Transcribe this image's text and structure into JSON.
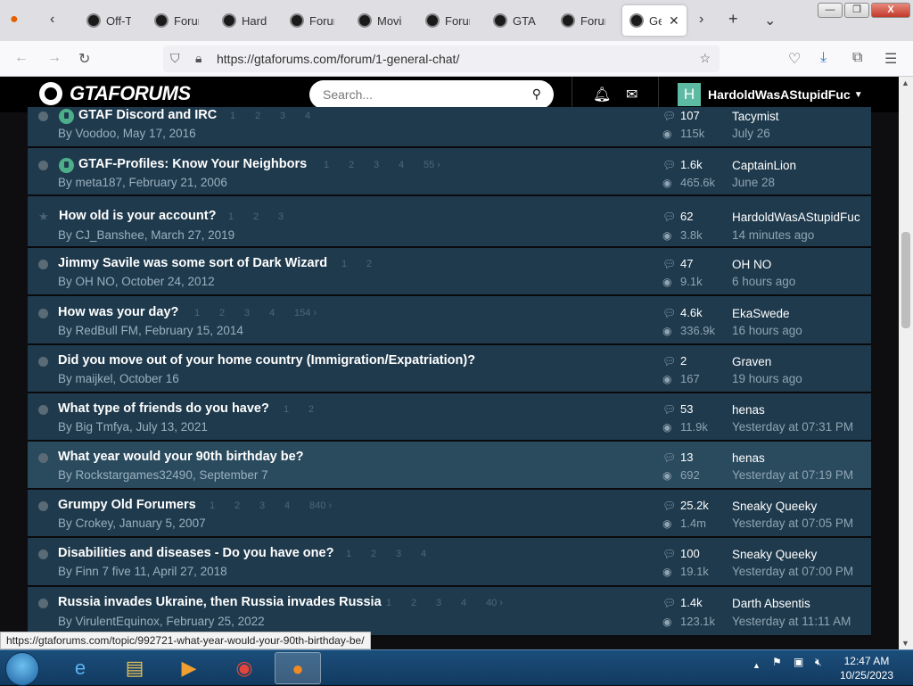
{
  "browser": {
    "tabs": [
      {
        "title": "Off-To"
      },
      {
        "title": "Forum"
      },
      {
        "title": "Hardc"
      },
      {
        "title": "Forum"
      },
      {
        "title": "Movie"
      },
      {
        "title": "Forum"
      },
      {
        "title": "GTA V"
      },
      {
        "title": "Forum"
      },
      {
        "title": "Ge"
      }
    ],
    "url": "https://gtaforums.com/forum/1-general-chat/",
    "status_url": "https://gtaforums.com/topic/992721-what-year-would-your-90th-birthday-be/",
    "window_buttons": [
      "—",
      "❐",
      "X"
    ]
  },
  "site": {
    "logo_text": "GTAFORUMS",
    "search_placeholder": "Search...",
    "user_initial": "H",
    "username": "HardoldWasAStupidFuc"
  },
  "topics": [
    {
      "title": "GTAF Discord and IRC",
      "pinned": true,
      "pages": [
        "1",
        "2",
        "3",
        "4"
      ],
      "by": "By Voodoo, May 17, 2016",
      "replies": "107",
      "views": "115k",
      "last_user": "Tacymist",
      "last_time": "July 26"
    },
    {
      "title": "GTAF-Profiles: Know Your Neighbors",
      "pinned": true,
      "pages": [
        "1",
        "2",
        "3",
        "4",
        "55 ›"
      ],
      "by": "By meta187, February 21, 2006",
      "replies": "1.6k",
      "views": "465.6k",
      "last_user": "CaptainLion",
      "last_time": "June 28"
    },
    {
      "title": "How old is your account?",
      "starred": true,
      "pages": [
        "1",
        "2",
        "3"
      ],
      "by": "By CJ_Banshee, March 27, 2019",
      "replies": "62",
      "views": "3.8k",
      "last_user": "HardoldWasAStupidFuc",
      "last_time": "14 minutes ago"
    },
    {
      "title": "Jimmy Savile was some sort of Dark Wizard",
      "pages": [
        "1",
        "2"
      ],
      "by": "By OH NO, October 24, 2012",
      "replies": "47",
      "views": "9.1k",
      "last_user": "OH NO",
      "last_time": "6 hours ago"
    },
    {
      "title": "How was your day?",
      "pages": [
        "1",
        "2",
        "3",
        "4",
        "154 ›"
      ],
      "by": "By RedBull FM, February 15, 2014",
      "replies": "4.6k",
      "views": "336.9k",
      "last_user": "EkaSwede",
      "last_time": "16 hours ago"
    },
    {
      "title": "Did you move out of your home country (Immigration/Expatriation)?",
      "pages": [],
      "by": "By maijkel, October 16",
      "replies": "2",
      "views": "167",
      "last_user": "Graven",
      "last_time": "19 hours ago"
    },
    {
      "title": "What type of friends do you have?",
      "pages": [
        "1",
        "2"
      ],
      "by": "By Big Tmfya, July 13, 2021",
      "replies": "53",
      "views": "11.9k",
      "last_user": "henas",
      "last_time": "Yesterday at 07:31 PM"
    },
    {
      "title": "What year would your 90th birthday be?",
      "hover": true,
      "pages": [],
      "by": "By Rockstargames32490, September 7",
      "replies": "13",
      "views": "692",
      "last_user": "henas",
      "last_time": "Yesterday at 07:19 PM"
    },
    {
      "title": "Grumpy Old Forumers",
      "pages": [
        "1",
        "2",
        "3",
        "4",
        "840 ›"
      ],
      "by": "By Crokey, January 5, 2007",
      "replies": "25.2k",
      "views": "1.4m",
      "last_user": "Sneaky Queeky",
      "last_time": "Yesterday at 07:05 PM"
    },
    {
      "title": "Disabilities and diseases - Do you have one?",
      "pages": [
        "1",
        "2",
        "3",
        "4"
      ],
      "by": "By Finn 7 five 11, April 27, 2018",
      "replies": "100",
      "views": "19.1k",
      "last_user": "Sneaky Queeky",
      "last_time": "Yesterday at 07:00 PM"
    },
    {
      "title": "Russia invades Ukraine, then Russia invades Russia",
      "pages": [
        "1",
        "2",
        "3",
        "4",
        "40 ›"
      ],
      "by": "By VirulentEquinox, February 25, 2022",
      "replies": "1.4k",
      "views": "123.1k",
      "last_user": "Darth Absentis",
      "last_time": "Yesterday at 11:11 AM"
    }
  ],
  "taskbar": {
    "time": "12:47 AM",
    "date": "10/25/2023"
  }
}
